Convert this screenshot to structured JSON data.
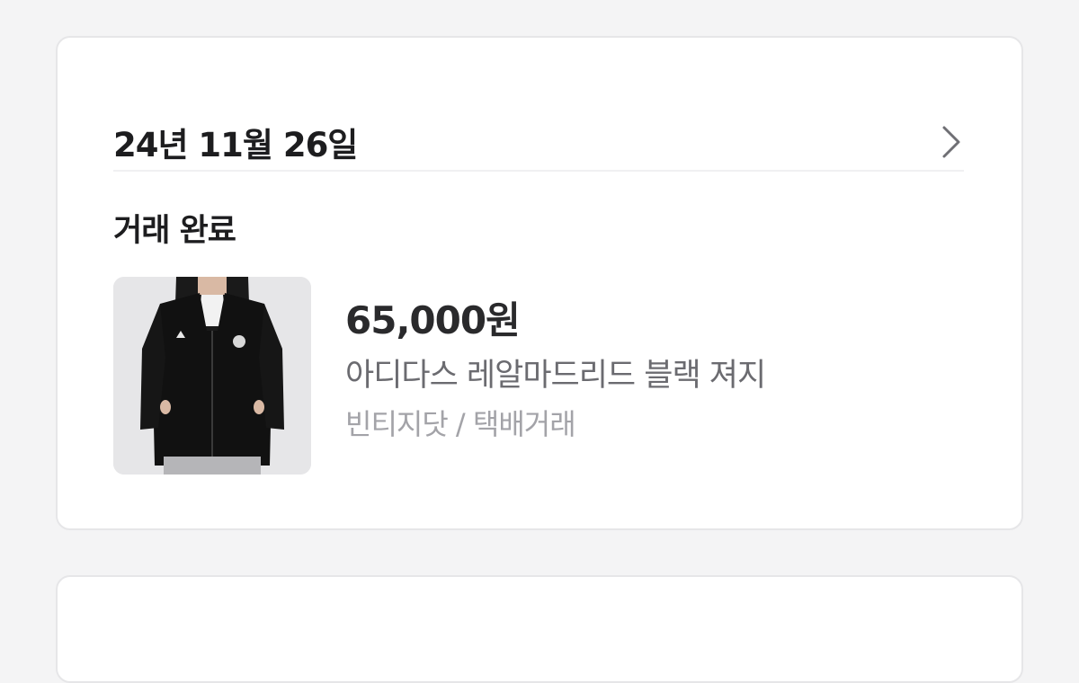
{
  "transaction": {
    "date": "24년 11월 26일",
    "status": "거래 완료",
    "item": {
      "price": "65,000원",
      "title": "아디다스 레알마드리드 블랙 져지",
      "meta": "빈티지닷 / 택배거래",
      "image_icon": "product-photo"
    }
  },
  "icons": {
    "chevron": "chevron-right-icon"
  }
}
